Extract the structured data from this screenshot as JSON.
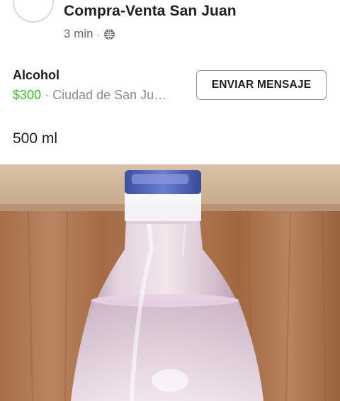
{
  "post": {
    "group_name": "Compra-Venta San Juan",
    "time": "3 min",
    "separator": "·",
    "privacy_icon": "globe-icon"
  },
  "listing": {
    "title": "Alcohol",
    "price": "$300",
    "separator": "·",
    "location": "Ciudad de San Ju…",
    "send_button_label": "ENVIAR MENSAJE"
  },
  "description": "500 ml",
  "photo": {
    "subject": "plastic-bottle-image"
  },
  "colors": {
    "price_green": "#42b72a",
    "muted_text": "#65676b",
    "text": "#1c1e21",
    "button_border": "#8d949e"
  }
}
